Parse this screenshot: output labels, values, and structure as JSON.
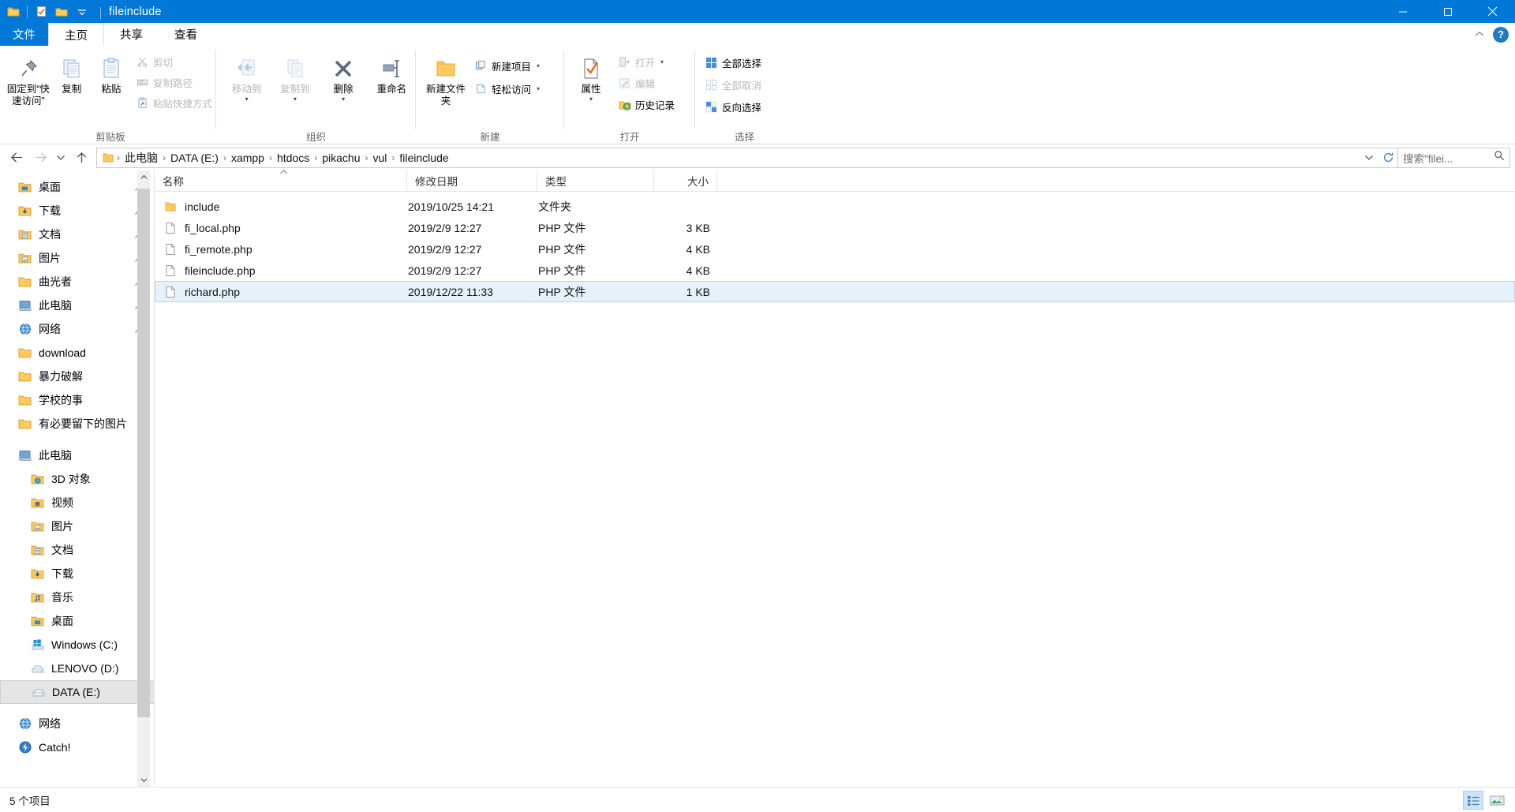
{
  "window": {
    "title": "fileinclude",
    "quick_access": [
      "folder-icon",
      "save-icon",
      "new-folder-icon",
      "chevron-down-icon"
    ],
    "controls": {
      "minimize": "minimize-icon",
      "maximize": "maximize-icon",
      "close": "close-icon"
    }
  },
  "tabs": [
    {
      "label": "文件",
      "name": "tab-file"
    },
    {
      "label": "主页",
      "name": "tab-home"
    },
    {
      "label": "共享",
      "name": "tab-share"
    },
    {
      "label": "查看",
      "name": "tab-view"
    }
  ],
  "tabstrip_right": {
    "collapse": "chevron-up-icon",
    "help": "?"
  },
  "ribbon": {
    "groups": [
      {
        "label": "剪贴板",
        "big": [
          {
            "label": "固定到“快速访问”",
            "icon": "pin-icon",
            "disabled": false
          },
          {
            "label": "复制",
            "icon": "copy-icon",
            "disabled": false
          },
          {
            "label": "粘贴",
            "icon": "paste-icon",
            "disabled": false
          }
        ],
        "small": [
          {
            "label": "剪切",
            "icon": "scissors-icon",
            "disabled": true
          },
          {
            "label": "复制路径",
            "icon": "copy-path-icon",
            "disabled": true
          },
          {
            "label": "粘贴快捷方式",
            "icon": "paste-shortcut-icon",
            "disabled": true
          }
        ]
      },
      {
        "label": "组织",
        "big": [
          {
            "label": "移动到",
            "icon": "move-to-icon",
            "disabled": true,
            "caret": true
          },
          {
            "label": "复制到",
            "icon": "copy-to-icon",
            "disabled": true,
            "caret": true
          },
          {
            "label": "删除",
            "icon": "delete-icon",
            "disabled": false,
            "caret": true
          },
          {
            "label": "重命名",
            "icon": "rename-icon",
            "disabled": false
          }
        ],
        "small": []
      },
      {
        "label": "新建",
        "big": [
          {
            "label": "新建文件夹",
            "icon": "new-folder-icon",
            "disabled": false
          }
        ],
        "small": [
          {
            "label": "新建项目",
            "icon": "new-item-icon",
            "disabled": false,
            "dropdown": true
          },
          {
            "label": "轻松访问",
            "icon": "easy-access-icon",
            "disabled": false,
            "dropdown": true
          }
        ]
      },
      {
        "label": "打开",
        "big": [
          {
            "label": "属性",
            "icon": "properties-icon",
            "disabled": false,
            "caret": true
          }
        ],
        "small": [
          {
            "label": "打开",
            "icon": "open-icon",
            "disabled": true,
            "dropdown": true
          },
          {
            "label": "编辑",
            "icon": "edit-icon",
            "disabled": true
          },
          {
            "label": "历史记录",
            "icon": "history-icon",
            "disabled": false
          }
        ]
      },
      {
        "label": "选择",
        "big": [],
        "small": [
          {
            "label": "全部选择",
            "icon": "select-all-icon",
            "disabled": false
          },
          {
            "label": "全部取消",
            "icon": "select-none-icon",
            "disabled": true
          },
          {
            "label": "反向选择",
            "icon": "invert-selection-icon",
            "disabled": false
          }
        ]
      }
    ]
  },
  "address": {
    "back": "back-arrow-icon",
    "forward": "forward-arrow-icon",
    "recent": "chevron-down-icon",
    "up": "up-arrow-icon",
    "crumbs": [
      "此电脑",
      "DATA (E:)",
      "xampp",
      "htdocs",
      "pikachu",
      "vul",
      "fileinclude"
    ],
    "dropdown": "chevron-down-icon",
    "refresh": "refresh-icon",
    "search_placeholder": "搜索\"filei...",
    "search_icon": "search-icon"
  },
  "navpane": {
    "quick": [
      {
        "label": "桌面",
        "icon": "desktop-folder-icon",
        "pinned": true
      },
      {
        "label": "下载",
        "icon": "downloads-folder-icon",
        "pinned": true
      },
      {
        "label": "文档",
        "icon": "documents-folder-icon",
        "pinned": true
      },
      {
        "label": "图片",
        "icon": "pictures-folder-icon",
        "pinned": true
      },
      {
        "label": "曲光者",
        "icon": "folder-icon",
        "pinned": true
      },
      {
        "label": "此电脑",
        "icon": "this-pc-icon",
        "pinned": true
      },
      {
        "label": "网络",
        "icon": "network-icon",
        "pinned": true
      },
      {
        "label": "download",
        "icon": "folder-icon",
        "pinned": false
      },
      {
        "label": "暴力破解",
        "icon": "folder-icon",
        "pinned": false
      },
      {
        "label": "学校的事",
        "icon": "folder-icon",
        "pinned": false
      },
      {
        "label": "有必要留下的图片",
        "icon": "folder-icon",
        "pinned": false
      }
    ],
    "thispc_root": {
      "label": "此电脑",
      "icon": "this-pc-icon"
    },
    "thispc": [
      {
        "label": "3D 对象",
        "icon": "3d-objects-icon"
      },
      {
        "label": "视频",
        "icon": "videos-folder-icon"
      },
      {
        "label": "图片",
        "icon": "pictures-folder-icon"
      },
      {
        "label": "文档",
        "icon": "documents-folder-icon"
      },
      {
        "label": "下载",
        "icon": "downloads-folder-icon"
      },
      {
        "label": "音乐",
        "icon": "music-folder-icon"
      },
      {
        "label": "桌面",
        "icon": "desktop-folder-icon"
      },
      {
        "label": "Windows (C:)",
        "icon": "windows-drive-icon"
      },
      {
        "label": "LENOVO (D:)",
        "icon": "drive-icon"
      },
      {
        "label": "DATA (E:)",
        "icon": "drive-icon",
        "selected": true
      }
    ],
    "bottom": [
      {
        "label": "网络",
        "icon": "network-icon"
      },
      {
        "label": "Catch!",
        "icon": "catch-icon"
      }
    ]
  },
  "filelist": {
    "columns": [
      {
        "key": "name",
        "label": "名称",
        "sorted": true
      },
      {
        "key": "date",
        "label": "修改日期"
      },
      {
        "key": "type",
        "label": "类型"
      },
      {
        "key": "size",
        "label": "大小"
      }
    ],
    "rows": [
      {
        "name": "include",
        "date": "2019/10/25 14:21",
        "type": "文件夹",
        "size": "",
        "icon": "folder-icon",
        "selected": false
      },
      {
        "name": "fi_local.php",
        "date": "2019/2/9 12:27",
        "type": "PHP 文件",
        "size": "3 KB",
        "icon": "file-icon",
        "selected": false
      },
      {
        "name": "fi_remote.php",
        "date": "2019/2/9 12:27",
        "type": "PHP 文件",
        "size": "4 KB",
        "icon": "file-icon",
        "selected": false
      },
      {
        "name": "fileinclude.php",
        "date": "2019/2/9 12:27",
        "type": "PHP 文件",
        "size": "4 KB",
        "icon": "file-icon",
        "selected": false
      },
      {
        "name": "richard.php",
        "date": "2019/12/22 11:33",
        "type": "PHP 文件",
        "size": "1 KB",
        "icon": "file-icon",
        "selected": true
      }
    ]
  },
  "statusbar": {
    "count_text": "5 个项目",
    "views": [
      {
        "name": "details-view-button",
        "icon": "details-view-icon",
        "active": true
      },
      {
        "name": "large-icons-view-button",
        "icon": "large-icons-view-icon",
        "active": false
      }
    ]
  }
}
